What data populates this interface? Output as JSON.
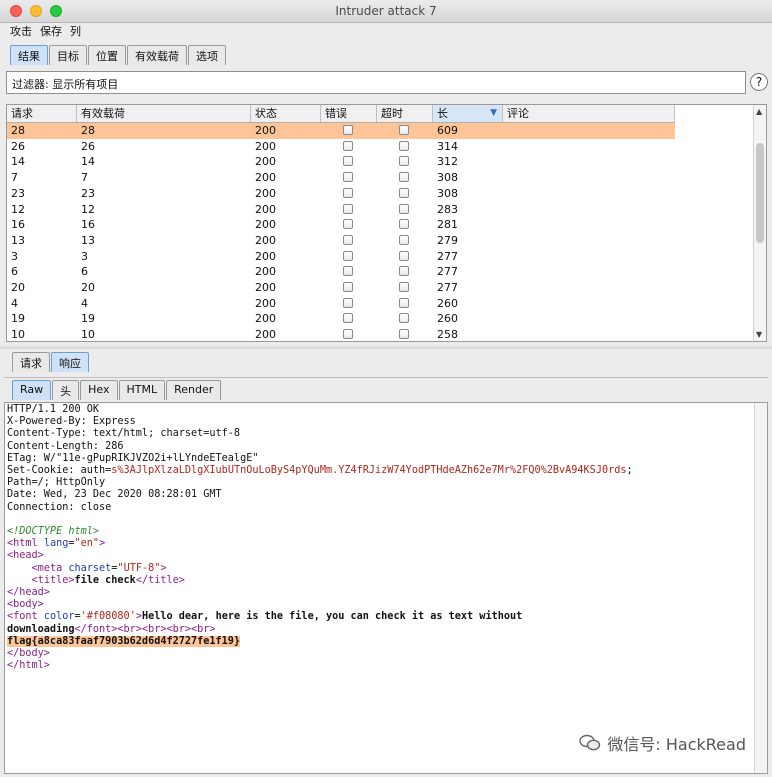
{
  "window": {
    "title": "Intruder attack 7"
  },
  "menu": [
    "攻击",
    "保存",
    "列"
  ],
  "top_tabs": [
    {
      "label": "结果",
      "active": true
    },
    {
      "label": "目标"
    },
    {
      "label": "位置"
    },
    {
      "label": "有效载荷"
    },
    {
      "label": "选项"
    }
  ],
  "filter": {
    "text": "过滤器:  显示所有项目",
    "help": "?"
  },
  "table": {
    "headers": [
      "请求",
      "有效载荷",
      "状态",
      "错误",
      "超时",
      "长",
      "评论"
    ],
    "rows": [
      [
        "28",
        "28",
        "200",
        "609"
      ],
      [
        "26",
        "26",
        "200",
        "314"
      ],
      [
        "14",
        "14",
        "200",
        "312"
      ],
      [
        "7",
        "7",
        "200",
        "308"
      ],
      [
        "23",
        "23",
        "200",
        "308"
      ],
      [
        "12",
        "12",
        "200",
        "283"
      ],
      [
        "16",
        "16",
        "200",
        "281"
      ],
      [
        "13",
        "13",
        "200",
        "279"
      ],
      [
        "3",
        "3",
        "200",
        "277"
      ],
      [
        "6",
        "6",
        "200",
        "277"
      ],
      [
        "20",
        "20",
        "200",
        "277"
      ],
      [
        "4",
        "4",
        "200",
        "260"
      ],
      [
        "19",
        "19",
        "200",
        "260"
      ],
      [
        "10",
        "10",
        "200",
        "258"
      ]
    ]
  },
  "mid_tabs": [
    {
      "label": "请求"
    },
    {
      "label": "响应",
      "active": true
    }
  ],
  "sub_tabs": [
    {
      "label": "Raw",
      "active": true
    },
    {
      "label": "头"
    },
    {
      "label": "Hex"
    },
    {
      "label": "HTML"
    },
    {
      "label": "Render"
    }
  ],
  "response": {
    "headers": [
      "HTTP/1.1 200 OK",
      "X-Powered-By: Express",
      "Content-Type: text/html; charset=utf-8",
      "Content-Length: 286",
      "ETag: W/\"11e-gPupRIKJVZO2i+lLYndeETealgE\""
    ],
    "cookie_name": "Set-Cookie: auth",
    "cookie_value": "s%3AJlpXlzaLDlgXIubUTnOuLoByS4pYQuMm.YZ4fRJizW74YodPTHdeAZh62e7Mr%2FQ0%2BvA94KSJ0rds",
    "cookie_rest": "Path=/; HttpOnly",
    "date": "Date: Wed, 23 Dec 2020 08:28:01 GMT",
    "connection": "Connection: close",
    "doctype": "<!DOCTYPE html>",
    "html_lang": "en",
    "meta_charset": "UTF-8",
    "title": "file check",
    "font_color": "'#f08080'",
    "body_text_1": "Hello dear, here is the file, you can check it as text without",
    "body_text_2": "downloading",
    "flag": "flag{a8ca83faaf7903b62d6d4f2727fe1f19}"
  },
  "watermark": "微信号: HackRead",
  "colors": {
    "selected_row": "#fdc597",
    "active_tab": "#cfe1f6"
  }
}
